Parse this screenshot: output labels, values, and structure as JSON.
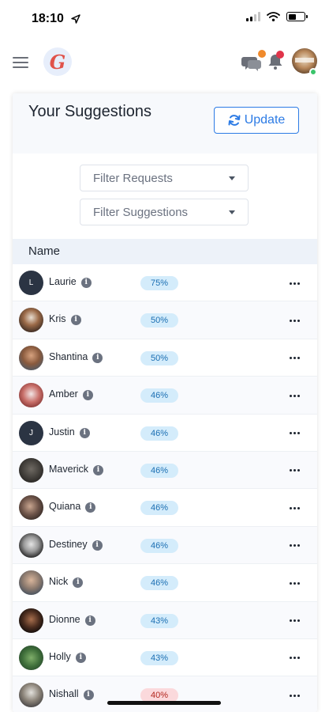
{
  "status_bar": {
    "time": "18:10"
  },
  "header": {
    "logo_letter": "G"
  },
  "card": {
    "title": "Your Suggestions",
    "update_label": "Update",
    "filter_requests": "Filter Requests",
    "filter_suggestions": "Filter Suggestions",
    "column_name": "Name"
  },
  "rows": [
    {
      "name": "Laurie",
      "initial": "L",
      "percent": "75%"
    },
    {
      "name": "Kris",
      "percent": "50%"
    },
    {
      "name": "Shantina",
      "percent": "50%"
    },
    {
      "name": "Amber",
      "percent": "46%"
    },
    {
      "name": "Justin",
      "initial": "J",
      "percent": "46%"
    },
    {
      "name": "Maverick",
      "percent": "46%"
    },
    {
      "name": "Quiana",
      "percent": "46%"
    },
    {
      "name": "Destiney",
      "percent": "46%"
    },
    {
      "name": "Nick",
      "percent": "46%"
    },
    {
      "name": "Dionne",
      "percent": "43%"
    },
    {
      "name": "Holly",
      "percent": "43%"
    },
    {
      "name": "Nishall",
      "percent": "40%"
    }
  ],
  "colors": {
    "accent": "#2c7be5",
    "pill_high": "#d4ecfb",
    "pill_low": "#fbd9dc",
    "logo": "#e0524a",
    "chat_badge": "#f08a2c",
    "bell_badge": "#e0344a",
    "online": "#3bc46b"
  },
  "icons": [
    "location-arrow-icon",
    "signal-icon",
    "wifi-icon",
    "battery-icon",
    "menu-icon",
    "chat-icon",
    "bell-icon",
    "refresh-icon",
    "info-icon",
    "more-icon"
  ]
}
